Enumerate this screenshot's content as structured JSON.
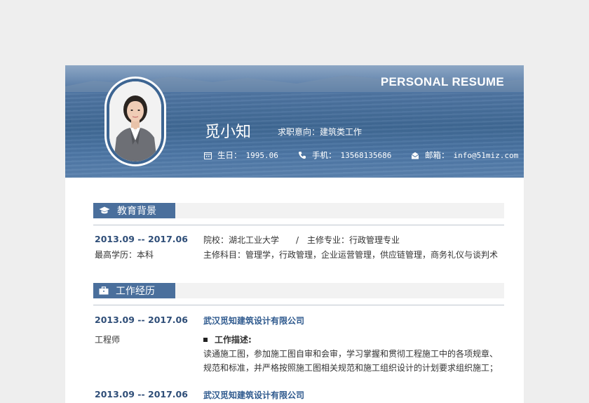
{
  "header": {
    "resume_title": "PERSONAL RESUME",
    "name": "觅小知",
    "objective": "求职意向：建筑类工作",
    "birthday_label": "生日：",
    "birthday": "1995.06",
    "phone_label": "手机：",
    "phone": "13568135686",
    "email_label": "邮箱：",
    "email": "info@51miz.com"
  },
  "education": {
    "title": "教育背景",
    "date": "2013.09 -- 2017.06",
    "degree": "最高学历：本科",
    "school_line": "院校：湖北工业大学　　/　主修专业：行政管理专业",
    "courses": "主修科目：管理学，行政管理，企业运营管理，供应链管理，商务礼仪与谈判术"
  },
  "work": {
    "title": "工作经历",
    "entries": [
      {
        "date": "2013.09 -- 2017.06",
        "company": "武汉觅知建筑设计有限公司",
        "role": "工程师",
        "desc_title": "工作描述:",
        "desc_line1": "读通施工图，参加施工图自审和会审，学习掌握和贯彻工程施工中的各项规章、",
        "desc_line2": "规范和标准，并严格按照施工图相关规范和施工组织设计的计划要求组织施工；"
      },
      {
        "date": "2013.09 -- 2017.06",
        "company": "武汉觅知建筑设计有限公司"
      }
    ]
  },
  "colors": {
    "accent": "#4a6f9c",
    "banner": "#4c73a0",
    "date_text": "#2f4e78"
  }
}
